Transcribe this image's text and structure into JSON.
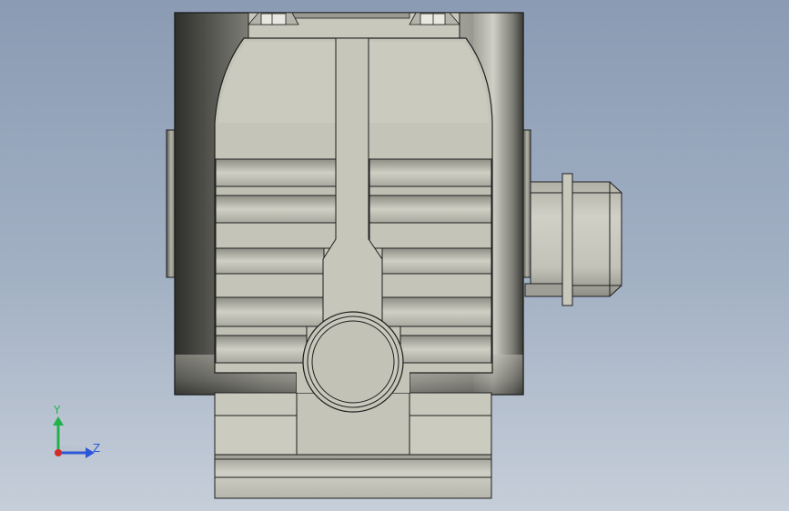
{
  "triad": {
    "y_label": "Y",
    "z_label": "Z",
    "y_color": "#22b24c",
    "z_color": "#2b57d8",
    "origin_color": "#d42a2a"
  },
  "colors": {
    "background_top": "#8a9bb3",
    "background_bottom": "#c6ced9",
    "body": "#c4c4b8",
    "body_light": "#d2d2c6",
    "edge": "#1e1e1e",
    "flange_dark": "#3a3a36"
  }
}
